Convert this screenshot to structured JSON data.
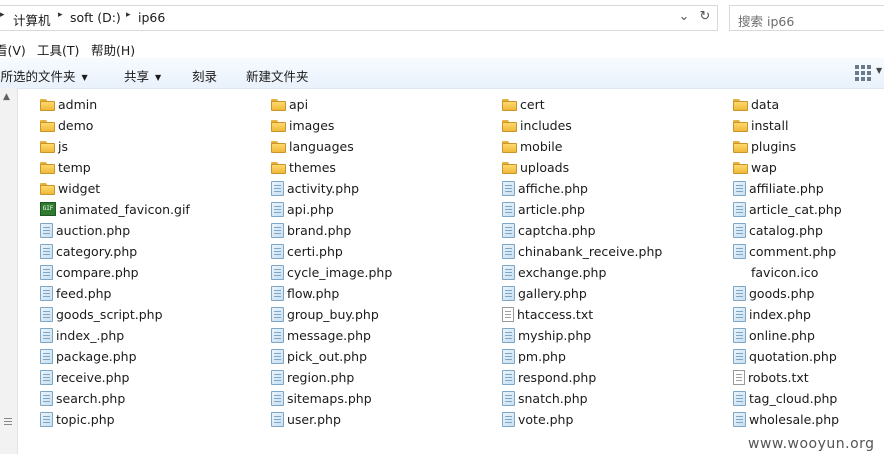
{
  "address_bar": {
    "crumbs": [
      "计算机",
      "soft (D:)",
      "ip66"
    ],
    "dropdown_glyph": "⌄",
    "refresh_glyph": "↻",
    "search_placeholder": "搜索 ip66"
  },
  "menu": {
    "items": [
      "看(V)",
      "工具(T)",
      "帮助(H)"
    ]
  },
  "command_bar": {
    "items": [
      "含所选的文件夹",
      "共享",
      "刻录",
      "新建文件夹"
    ]
  },
  "files": {
    "columns": [
      [
        {
          "name": "admin",
          "type": "folder"
        },
        {
          "name": "demo",
          "type": "folder"
        },
        {
          "name": "js",
          "type": "folder"
        },
        {
          "name": "temp",
          "type": "folder"
        },
        {
          "name": "widget",
          "type": "folder"
        },
        {
          "name": "animated_favicon.gif",
          "type": "gif"
        },
        {
          "name": "auction.php",
          "type": "php"
        },
        {
          "name": "category.php",
          "type": "php"
        },
        {
          "name": "compare.php",
          "type": "php"
        },
        {
          "name": "feed.php",
          "type": "php"
        },
        {
          "name": "goods_script.php",
          "type": "php"
        },
        {
          "name": "index_.php",
          "type": "php"
        },
        {
          "name": "package.php",
          "type": "php"
        },
        {
          "name": "receive.php",
          "type": "php"
        },
        {
          "name": "search.php",
          "type": "php"
        },
        {
          "name": "topic.php",
          "type": "php"
        }
      ],
      [
        {
          "name": "api",
          "type": "folder"
        },
        {
          "name": "images",
          "type": "folder"
        },
        {
          "name": "languages",
          "type": "folder"
        },
        {
          "name": "themes",
          "type": "folder"
        },
        {
          "name": "activity.php",
          "type": "php"
        },
        {
          "name": "api.php",
          "type": "php"
        },
        {
          "name": "brand.php",
          "type": "php"
        },
        {
          "name": "certi.php",
          "type": "php"
        },
        {
          "name": "cycle_image.php",
          "type": "php"
        },
        {
          "name": "flow.php",
          "type": "php"
        },
        {
          "name": "group_buy.php",
          "type": "php"
        },
        {
          "name": "message.php",
          "type": "php"
        },
        {
          "name": "pick_out.php",
          "type": "php"
        },
        {
          "name": "region.php",
          "type": "php"
        },
        {
          "name": "sitemaps.php",
          "type": "php"
        },
        {
          "name": "user.php",
          "type": "php"
        }
      ],
      [
        {
          "name": "cert",
          "type": "folder"
        },
        {
          "name": "includes",
          "type": "folder"
        },
        {
          "name": "mobile",
          "type": "folder"
        },
        {
          "name": "uploads",
          "type": "folder"
        },
        {
          "name": "affiche.php",
          "type": "php"
        },
        {
          "name": "article.php",
          "type": "php"
        },
        {
          "name": "captcha.php",
          "type": "php"
        },
        {
          "name": "chinabank_receive.php",
          "type": "php"
        },
        {
          "name": "exchange.php",
          "type": "php"
        },
        {
          "name": "gallery.php",
          "type": "php"
        },
        {
          "name": "htaccess.txt",
          "type": "txt"
        },
        {
          "name": "myship.php",
          "type": "php"
        },
        {
          "name": "pm.php",
          "type": "php"
        },
        {
          "name": "respond.php",
          "type": "php"
        },
        {
          "name": "snatch.php",
          "type": "php"
        },
        {
          "name": "vote.php",
          "type": "php"
        }
      ],
      [
        {
          "name": "data",
          "type": "folder"
        },
        {
          "name": "install",
          "type": "folder"
        },
        {
          "name": "plugins",
          "type": "folder"
        },
        {
          "name": "wap",
          "type": "folder"
        },
        {
          "name": "affiliate.php",
          "type": "php"
        },
        {
          "name": "article_cat.php",
          "type": "php"
        },
        {
          "name": "catalog.php",
          "type": "php"
        },
        {
          "name": "comment.php",
          "type": "php"
        },
        {
          "name": "favicon.ico",
          "type": "ico"
        },
        {
          "name": "goods.php",
          "type": "php"
        },
        {
          "name": "index.php",
          "type": "php"
        },
        {
          "name": "online.php",
          "type": "php"
        },
        {
          "name": "quotation.php",
          "type": "php"
        },
        {
          "name": "robots.txt",
          "type": "txt"
        },
        {
          "name": "tag_cloud.php",
          "type": "php"
        },
        {
          "name": "wholesale.php",
          "type": "php"
        }
      ]
    ]
  },
  "watermark": "www.wooyun.org"
}
